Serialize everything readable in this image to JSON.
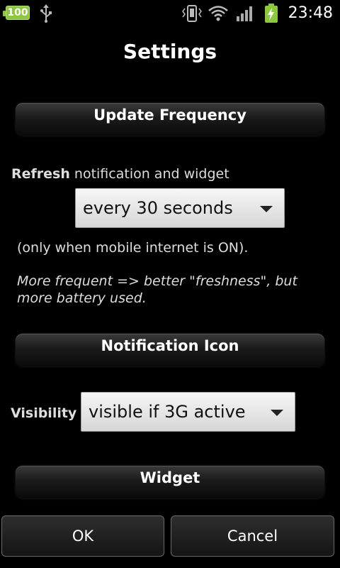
{
  "statusbar": {
    "battery_level": "100",
    "clock": "23:48",
    "icons": [
      "usb-icon",
      "vibrate-icon",
      "wifi-icon",
      "signal-icon",
      "battery-charging-icon"
    ]
  },
  "title": "Settings",
  "sections": {
    "update": {
      "header": "Update Frequency"
    },
    "notification": {
      "header": "Notification Icon"
    },
    "widget": {
      "header": "Widget"
    }
  },
  "refresh": {
    "label_bold": "Refresh",
    "label_rest": " notification and widget",
    "selected": "every 30 seconds",
    "note": "(only when mobile internet is ON).",
    "hint": "More frequent => better \"freshness\", but more battery used."
  },
  "visibility": {
    "label": "Visibility",
    "selected": "visible if 3G active"
  },
  "buttons": {
    "ok": "OK",
    "cancel": "Cancel"
  },
  "colors": {
    "battery_green": "#8dc63f",
    "background": "#000000"
  }
}
